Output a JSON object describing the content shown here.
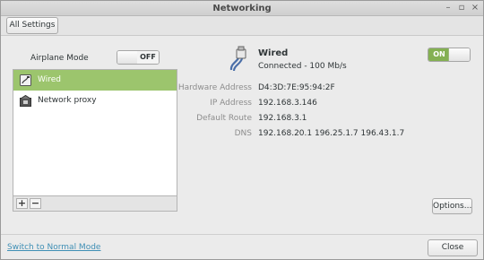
{
  "window": {
    "title": "Networking",
    "controls": [
      "–",
      "▫",
      "×"
    ]
  },
  "toolbar": {
    "all_settings_label": "All Settings"
  },
  "airplane": {
    "label": "Airplane Mode",
    "state": "OFF"
  },
  "devices": {
    "items": [
      {
        "label": "Wired",
        "icon": "wired-icon",
        "selected": true
      },
      {
        "label": "Network proxy",
        "icon": "proxy-icon",
        "selected": false
      }
    ],
    "add_label": "+",
    "remove_label": "−"
  },
  "detail": {
    "title": "Wired",
    "status": "Connected - 100 Mb/s",
    "switch_state": "ON",
    "properties": [
      {
        "label": "Hardware Address",
        "value": "D4:3D:7E:95:94:2F"
      },
      {
        "label": "IP Address",
        "value": "192.168.3.146"
      },
      {
        "label": "Default Route",
        "value": "192.168.3.1"
      },
      {
        "label": "DNS",
        "value": "192.168.20.1 196.25.1.7 196.43.1.7"
      }
    ],
    "options_label": "Options..."
  },
  "footer": {
    "mode_link": "Switch to Normal Mode",
    "close_label": "Close"
  },
  "colors": {
    "accent_green": "#84b052",
    "selection_green": "#9cc56d",
    "link_blue": "#3f8fb5"
  }
}
